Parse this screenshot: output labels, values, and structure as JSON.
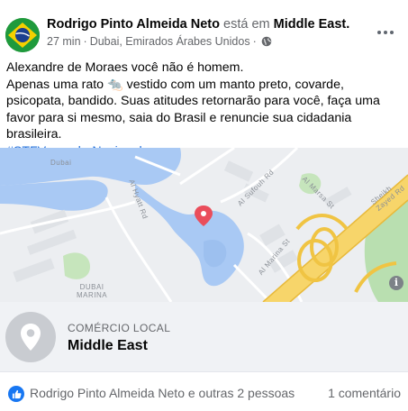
{
  "post": {
    "author": "Rodrigo Pinto Almeida Neto",
    "location_connector": "está em",
    "location": "Middle East.",
    "time": "27 min",
    "dot": "·",
    "place_detail": "Dubai, Emirados Árabes Unidos",
    "visibility_icon": "globe-icon",
    "more_icon": "more-options-icon",
    "text_line1": "Alexandre de Moraes você não é homem.",
    "text_line2": "Apenas uma rato 🐀 vestido com um manto preto, covarde, psicopata, bandido. Suas atitudes retornarão para você, faça uma favor para si mesmo, saia do Brasil e renuncie sua cidadania brasileira.",
    "hashtag": "#STFVergonhaNacional"
  },
  "map": {
    "labels": {
      "dubai_marina": "DUBAI\nMARINA",
      "dubai_top": "Dubai",
      "hyatt": "Al Hyatt Rd",
      "sufouh": "Al Sufouh Rd",
      "marina_st": "Al Marina St",
      "marsa": "Al Marsa St",
      "sheikh": "Sheikh Zayed Rd",
      "info": "i"
    },
    "water_color": "#a9c9f4",
    "road_color": "#f7d56a",
    "park_color": "#b9dfb0",
    "pin_color": "#ea4d5b"
  },
  "place": {
    "type": "COMÉRCIO LOCAL",
    "name": "Middle East",
    "icon": "map-pin-icon"
  },
  "footer": {
    "reaction_icon": "like-icon",
    "reactors": "Rodrigo Pinto Almeida Neto e outras 2 pessoas",
    "comments": "1 comentário"
  },
  "colors": {
    "link": "#216fdb",
    "secondary_text": "#65676b",
    "like_blue": "#1877f2"
  }
}
